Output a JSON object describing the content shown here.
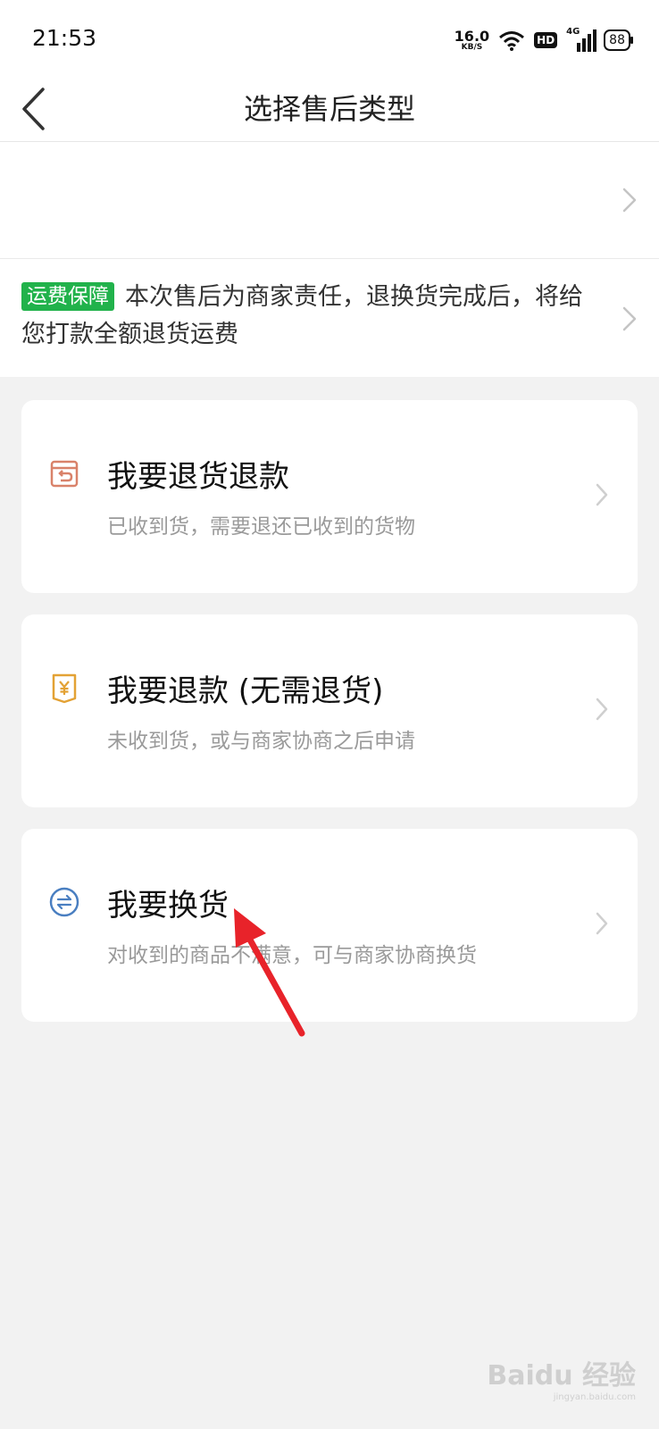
{
  "status_bar": {
    "time": "21:53",
    "net_speed_value": "16.0",
    "net_speed_unit": "KB/S",
    "hd_label": "HD",
    "network_label": "4G",
    "battery_level": "88"
  },
  "header": {
    "title": "选择售后类型",
    "back_icon": "chevron-left-icon"
  },
  "notice": {
    "badge": "运费保障",
    "text": "本次售后为商家责任，退换货完成后，将给您打款全额退货运费"
  },
  "options": [
    {
      "icon": "return-box-icon",
      "title": "我要退货退款",
      "subtitle": "已收到货，需要退还已收到的货物",
      "icon_color": "#d9826a"
    },
    {
      "icon": "yuan-refund-icon",
      "title": "我要退款 (无需退货)",
      "subtitle": "未收到货，或与商家协商之后申请",
      "icon_color": "#e3a235"
    },
    {
      "icon": "exchange-icon",
      "title": "我要换货",
      "subtitle": "对收到的商品不满意，可与商家协商换货",
      "icon_color": "#4a7fc1"
    }
  ],
  "colors": {
    "badge_green": "#21b24b",
    "background": "#f2f2f2",
    "annotation_arrow": "#e8232a"
  },
  "watermark": {
    "brand": "Baidu 经验",
    "url": "jingyan.baidu.com"
  }
}
